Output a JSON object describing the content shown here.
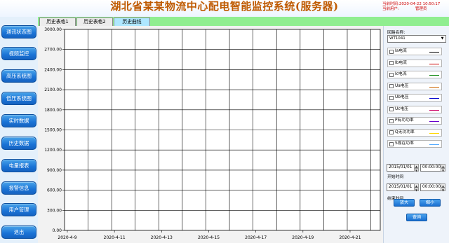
{
  "header": {
    "title": "湖北省某某物流中心配电智能监控系统(服务器)",
    "time_label": "当前时间:",
    "time_value": "2020-04-22 10:50:17",
    "user_label": "当前用户:",
    "user_value": "管理员"
  },
  "sidebar": {
    "items": [
      "通讯状态图",
      "视频监控",
      "高压系统图",
      "低压系统图",
      "实时数据",
      "历史数据",
      "电量报表",
      "报警信息",
      "用户管理",
      "退出"
    ]
  },
  "tabs": [
    "历史表格1",
    "历史表格2",
    "历史曲线"
  ],
  "active_tab": 2,
  "panel": {
    "loop_label": "回路名称:",
    "loop_value": "WT1041",
    "series": [
      {
        "label": "Ia电流",
        "color": "#000000"
      },
      {
        "label": "Ib电流",
        "color": "#cc0000"
      },
      {
        "label": "Ic电流",
        "color": "#008000"
      },
      {
        "label": "Ua电压",
        "color": "#cc6600"
      },
      {
        "label": "Ub电压",
        "color": "#0000cc"
      },
      {
        "label": "Uc电压",
        "color": "#cc0066"
      },
      {
        "label": "P有功功率",
        "color": "#6600cc"
      },
      {
        "label": "Q无功功率",
        "color": "#ffd700"
      },
      {
        "label": "S视在功率",
        "color": "#4fa8ff"
      }
    ],
    "start_label": "开始时间",
    "start_date": "2015/01/01",
    "start_time": "00:00:00",
    "end_label": "结束时间",
    "end_date": "2015/01/01",
    "end_time": "00:00:00",
    "zoom_in": "放大",
    "zoom_out": "缩小",
    "query": "查询"
  },
  "chart_data": {
    "type": "line",
    "x": [
      "2020-4-9",
      "2020-4-11",
      "2020-4-13",
      "2020-4-15",
      "2020-4-17",
      "2020-4-19",
      "2020-4-21"
    ],
    "y_ticks": [
      "3000.00",
      "2700.00",
      "2400.00",
      "2100.00",
      "1800.00",
      "1500.00",
      "1200.00",
      "900.00",
      "600.00",
      "300.00",
      "0.00"
    ],
    "ylim": [
      0,
      3000
    ],
    "grid": true,
    "series": []
  }
}
